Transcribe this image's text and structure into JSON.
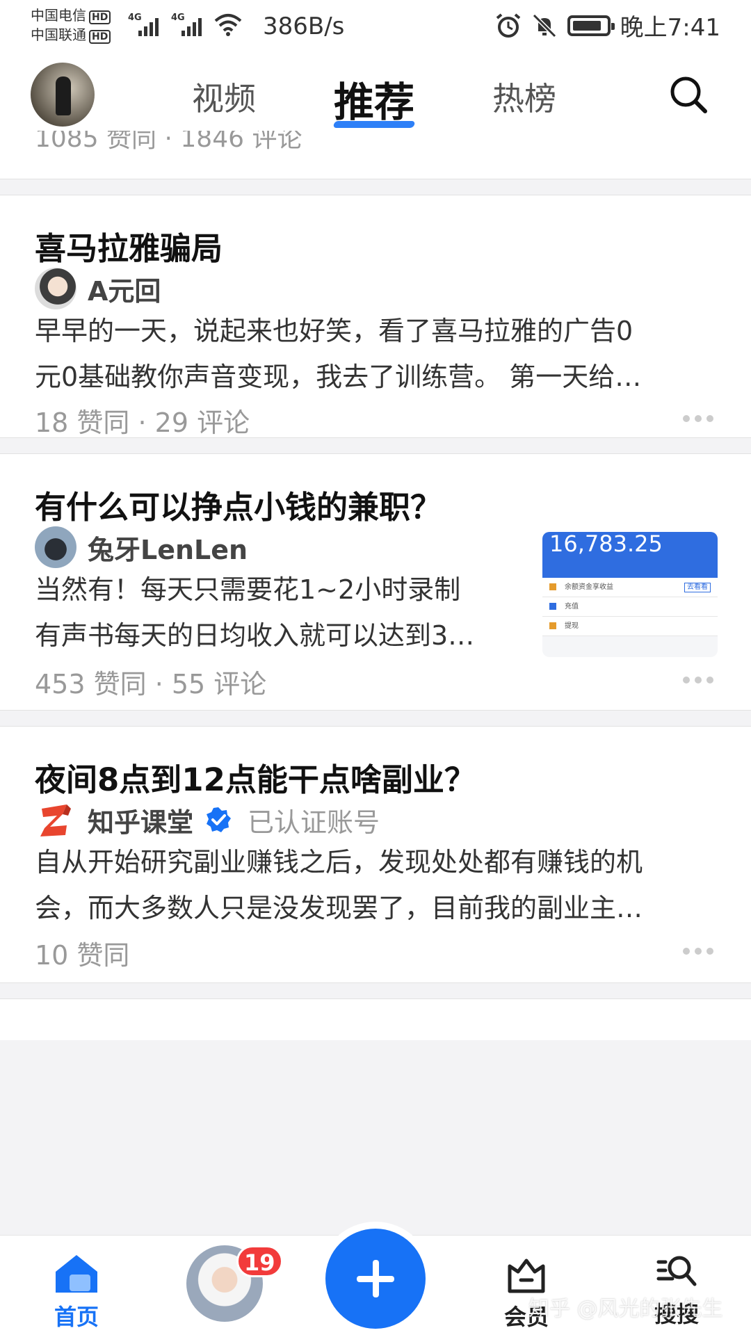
{
  "status_bar": {
    "carrier1": "中国电信",
    "carrier2": "中国联通",
    "hd": "HD",
    "net_type1": "4G",
    "net_type2": "4G",
    "net_speed": "386B/s",
    "time": "晚上7:41"
  },
  "top_nav": {
    "tabs": [
      "视频",
      "推荐",
      "热榜"
    ],
    "active_tab": "推荐"
  },
  "feed": {
    "partial_meta": "1085 赞同 · 1846 评论",
    "cards": [
      {
        "title": "喜马拉雅骗局",
        "author": "A元回",
        "excerpt_line1": "早早的一天，说起来也好笑，看了喜马拉雅的广告0",
        "excerpt_line2": "元0基础教你声音变现，我去了训练营。 第一天给…",
        "meta": "18 赞同 · 29 评论"
      },
      {
        "title": "有什么可以挣点小钱的兼职？",
        "author": "兔牙LenLen",
        "excerpt_line1": "当然有！每天只需要花1~2小时录制",
        "excerpt_line2": "有声书每天的日均收入就可以达到3…",
        "meta": "453 赞同 · 55 评论",
        "thumb": {
          "amount": "16,783.25",
          "row1": "余额资金享收益",
          "row1_btn": "去看看",
          "row2": "充值",
          "row3": "提现"
        }
      },
      {
        "title": "夜间8点到12点能干点啥副业？",
        "author": "知乎课堂",
        "verified_label": "已认证账号",
        "excerpt_line1": "自从开始研究副业赚钱之后，发现处处都有赚钱的机",
        "excerpt_line2": "会，而大多数人只是没发现罢了，目前我的副业主…",
        "meta": "10 赞同"
      }
    ]
  },
  "bottom_nav": {
    "home_label": "首页",
    "badge_count": "19",
    "vip_label": "会员",
    "search_label": "搜搜"
  },
  "watermark": "知乎 @风光的张先生",
  "colors": {
    "accent": "#1772f6",
    "badge": "#f23b3b",
    "muted_text": "#999999"
  }
}
